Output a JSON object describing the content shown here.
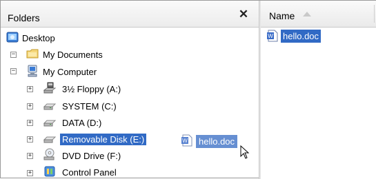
{
  "folders_pane": {
    "title": "Folders",
    "close_glyph": "✕"
  },
  "tree": {
    "desktop": "Desktop",
    "my_documents": "My Documents",
    "my_computer": "My Computer",
    "floppy": "3½ Floppy (A:)",
    "system": "SYSTEM (C:)",
    "data": "DATA (D:)",
    "removable": "Removable Disk (E:)",
    "dvd": "DVD Drive (F:)",
    "control_panel": "Control Panel",
    "expand_glyph": "+",
    "collapse_glyph": "−"
  },
  "files_pane": {
    "column_name": "Name",
    "file_name": "hello.doc"
  },
  "drag": {
    "label": "hello.doc"
  },
  "colors": {
    "selection": "#316ac5",
    "drag_selection": "#5a86cf"
  }
}
